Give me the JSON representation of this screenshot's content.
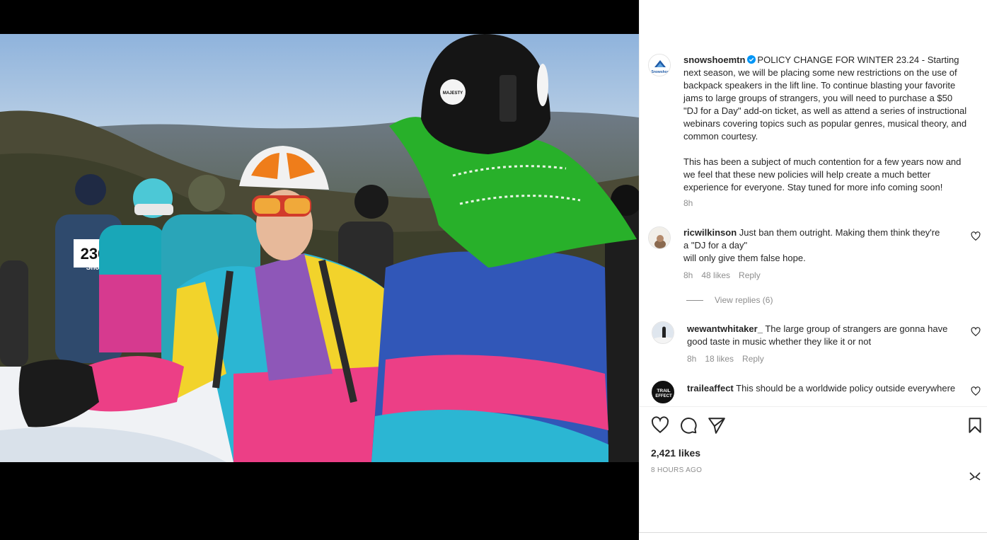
{
  "post": {
    "author": "snowshoemtn",
    "avatar_text": "Snowshoe",
    "caption_p1": "POLICY CHANGE FOR WINTER 23.24 - Starting next season, we will be placing some new restrictions on the use of backpack speakers in the lift line. To continue blasting your favorite jams to large groups of strangers, you will need to purchase a $50 \"DJ for a Day\" add-on ticket, as well as attend a series of instructional webinars covering topics such as popular genres, musical theory, and common courtesy.",
    "caption_p2": "This has been a subject of much contention for a few years now and we feel that these new policies will help create a much better experience for everyone. Stay tuned for more info coming soon!",
    "time": "8h",
    "likes": "2,421 likes",
    "posted_ago": "8 HOURS AGO"
  },
  "photo": {
    "bib_number": "236",
    "bib_brand": "Snow",
    "helmet_sticker": "MAJESTY"
  },
  "comments": [
    {
      "user": "ricwilkinson",
      "text_line1": "Just ban them outright. Making them think they're",
      "text_line2": "a \"DJ for a day\"",
      "text_line3": "will only give them false hope.",
      "time": "8h",
      "likes": "48 likes",
      "reply": "Reply",
      "view_replies": "View replies (6)"
    },
    {
      "user": "wewantwhitaker_",
      "text": "The large group of strangers are gonna have good taste in music whether they like it or not",
      "time": "8h",
      "likes": "18 likes",
      "reply": "Reply"
    },
    {
      "user": "traileaffect",
      "avatar_text_1": "TRAIL",
      "avatar_text_2": "EFFECT",
      "text": "This should be a worldwide policy outside everywhere"
    }
  ],
  "icons": {
    "like": "heart-icon",
    "comment": "comment-icon",
    "share": "paper-plane-icon",
    "save": "bookmark-icon",
    "close": "collapse-icon"
  },
  "colors": {
    "verified": "#0095f6",
    "muted": "#8e8e8e",
    "text": "#262626"
  }
}
